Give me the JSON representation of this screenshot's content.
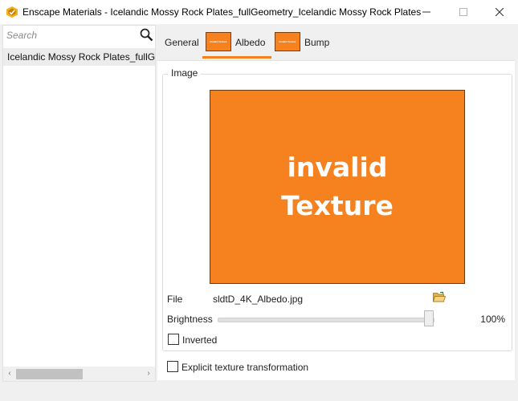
{
  "window": {
    "title": "Enscape Materials - Icelandic Mossy Rock Plates_fullGeometry_Icelandic Mossy Rock Plates",
    "app_icon": "enscape-logo-icon",
    "controls": [
      "minimize-icon",
      "maximize-icon",
      "close-icon"
    ]
  },
  "sidebar": {
    "search": {
      "placeholder": "Search",
      "value": "",
      "icon": "search-icon"
    },
    "items": [
      {
        "label": "Icelandic Mossy Rock Plates_fullGeometry_Icelandic Mossy Rock Plates",
        "selected": true
      }
    ],
    "scrollbar": {
      "left_arrow": "‹",
      "right_arrow": "›"
    }
  },
  "tabs": [
    {
      "label": "General",
      "active": false,
      "thumbnail": false
    },
    {
      "label": "Albedo",
      "active": true,
      "thumbnail": true,
      "thumbnail_text": "Invalid Texture"
    },
    {
      "label": "Bump",
      "active": false,
      "thumbnail": true,
      "thumbnail_text": "Invalid Texture"
    }
  ],
  "image_group": {
    "label": "Image",
    "preview": {
      "line1": "invalid",
      "line2": "Texture",
      "color": "#f5821f"
    },
    "file": {
      "label": "File",
      "value": "sldtD_4K_Albedo.jpg",
      "browse_icon": "folder-open-icon"
    },
    "brightness": {
      "label": "Brightness",
      "value": 100,
      "value_text": "100%"
    },
    "inverted": {
      "label": "Inverted",
      "checked": false
    }
  },
  "explicit_transform": {
    "label": "Explicit texture transformation",
    "checked": false
  },
  "colors": {
    "accent": "#f5821f",
    "background": "#f0f0f0",
    "panel": "#ffffff"
  }
}
